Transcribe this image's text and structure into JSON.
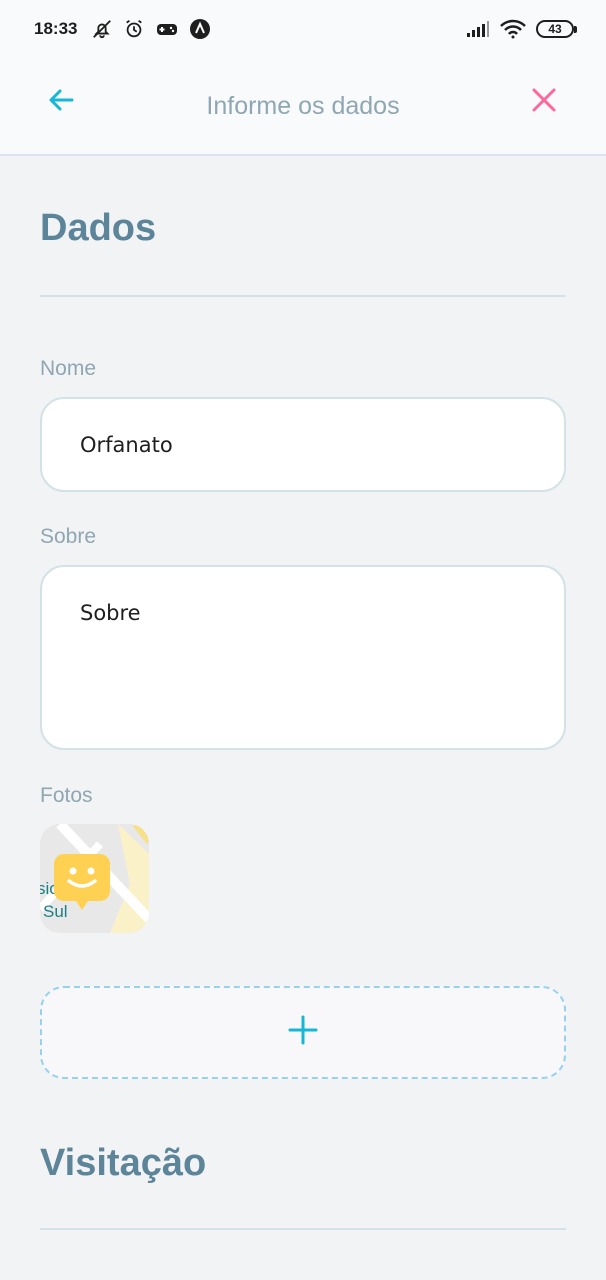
{
  "status_bar": {
    "time": "18:33",
    "battery": "43",
    "icons": [
      "bell-off-icon",
      "alarm-icon",
      "game-controller-icon",
      "app-badge-icon",
      "signal-icon",
      "wifi-icon",
      "battery-icon"
    ]
  },
  "header": {
    "title": "Informe os dados",
    "back_icon": "arrow-left-icon",
    "close_icon": "close-icon",
    "accent": "#15b6d6",
    "close_color": "#ff669d"
  },
  "sections": {
    "data_title": "Dados",
    "visitation_title": "Visitação"
  },
  "form": {
    "name_label": "Nome",
    "name_value": "Orfanato",
    "about_label": "Sobre",
    "about_value": "Sobre",
    "photos_label": "Fotos",
    "photo_thumb_text": "sic\nSul",
    "add_icon": "plus-icon"
  },
  "colors": {
    "title": "#5c8599",
    "label": "#8fa7b2",
    "border": "#d3e2e6",
    "dashed_border": "#96d2f0",
    "background": "#f2f3f5"
  }
}
